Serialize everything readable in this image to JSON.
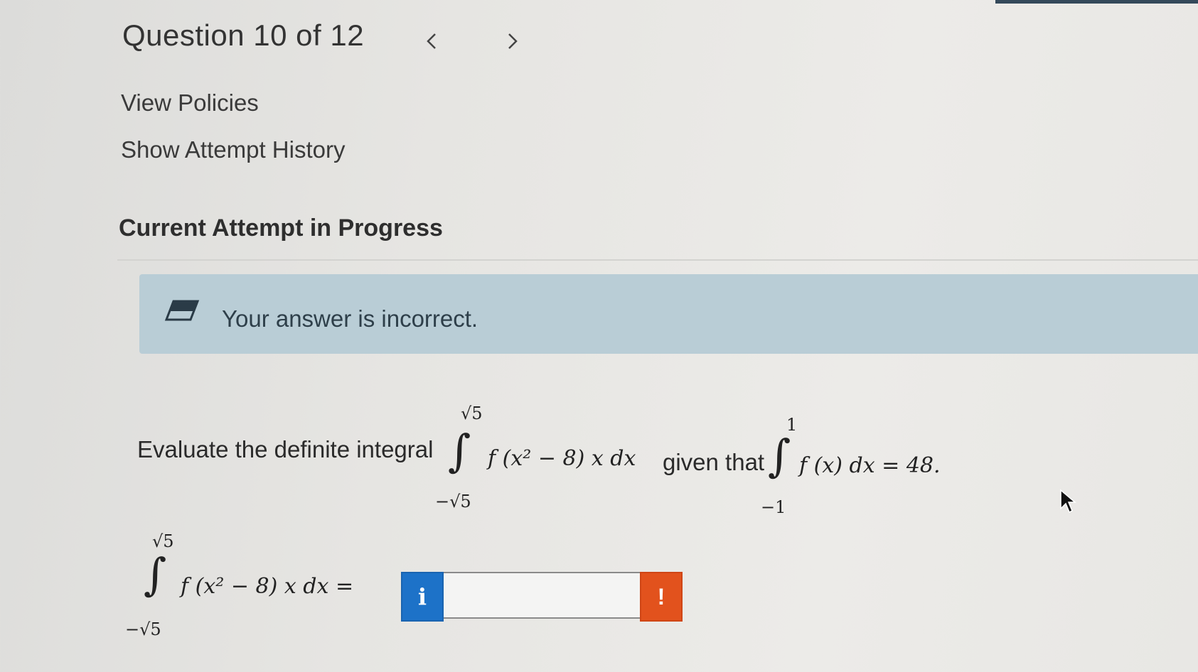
{
  "header": {
    "title": "Question 10 of 12",
    "prev_icon": "chevron-left-icon",
    "next_icon": "chevron-right-icon"
  },
  "links": {
    "view_policies": "View Policies",
    "show_attempt_history": "Show Attempt History"
  },
  "section": {
    "title": "Current Attempt in Progress"
  },
  "feedback": {
    "icon": "eraser-icon",
    "message": "Your answer is incorrect.",
    "color": "#b9cdd6"
  },
  "question": {
    "prompt": "Evaluate the definite integral",
    "integral_upper": "√5",
    "integral_lower": "−√5",
    "integrand": "f (x² − 8) x dx",
    "given_text": "given that",
    "given_upper": "1",
    "given_lower": "−1",
    "given_integrand": "f (x) dx = 48."
  },
  "answer": {
    "lhs_upper": "√5",
    "lhs_lower": "−√5",
    "lhs_integrand": "f (x² − 8) x dx =",
    "value": "",
    "info_label": "i",
    "warn_label": "!",
    "info_color": "#1d72c8",
    "warn_color": "#e2521d"
  }
}
